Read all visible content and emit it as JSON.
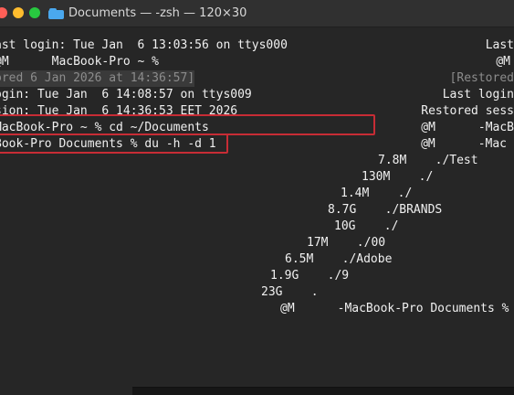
{
  "window": {
    "title": "Documents — -zsh — 120×30",
    "icon": "folder-icon"
  },
  "colors": {
    "background": "#262626",
    "titlebar": "#303030",
    "text": "#f0f0f0",
    "dim_text": "#8c8c8c",
    "highlight_border": "#c72c35",
    "close": "#ff5f57",
    "minimize": "#febc2e",
    "zoom": "#28c840"
  },
  "left_pane": {
    "lines": [
      "ast login: Tue Jan  6 13:03:56 on ttys000",
      "@M      MacBook-Pro ~ %",
      "ored 6 Jan 2026 at 14:36:57]",
      "ogin: Tue Jan  6 14:08:57 on ttys009",
      "sion: Tue Jan  6 14:36:53 EET 2026",
      "MacBook-Pro ~ % cd ~/Documents",
      "Book-Pro Documents % du -h -d 1"
    ]
  },
  "right_pane": {
    "lines": [
      "Last",
      "@M",
      "[Restored",
      "Last login",
      "Restored sess",
      "@M      -MacB",
      "@M      -Mac",
      "7.8M    ./Test",
      "130M    ./",
      "1.4M    ./",
      "8.7G    ./BRANDS",
      "10G    ./",
      "17M    ./00",
      "6.5M    ./Adobe",
      "1.9G    ./9",
      "23G    .",
      "@M      -MacBook-Pro Documents %"
    ]
  }
}
